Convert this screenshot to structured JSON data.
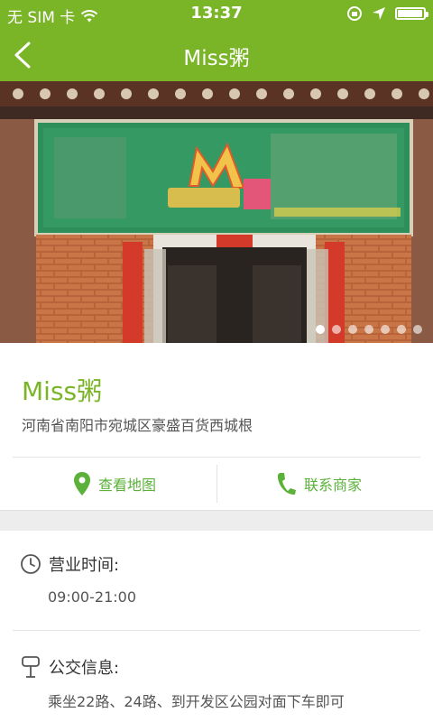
{
  "status_bar": {
    "carrier": "无 SIM 卡",
    "time": "13:37",
    "battery_level": 0.95
  },
  "nav": {
    "title": "Miss粥",
    "back_icon": "chevron-left-icon"
  },
  "gallery": {
    "slide_count": 7,
    "active_index": 0
  },
  "shop": {
    "name": "Miss粥",
    "address": "河南省南阳市宛城区豪盛百货西城根"
  },
  "actions": {
    "map_label": "查看地图",
    "call_label": "联系商家"
  },
  "details": {
    "hours_label": "营业时间:",
    "hours_value": "09:00-21:00",
    "bus_label": "公交信息:",
    "bus_value": "乘坐22路、24路、到开发区公园对面下车即可"
  },
  "colors": {
    "brand": "#7ab528",
    "action_green": "#5bb13a"
  }
}
